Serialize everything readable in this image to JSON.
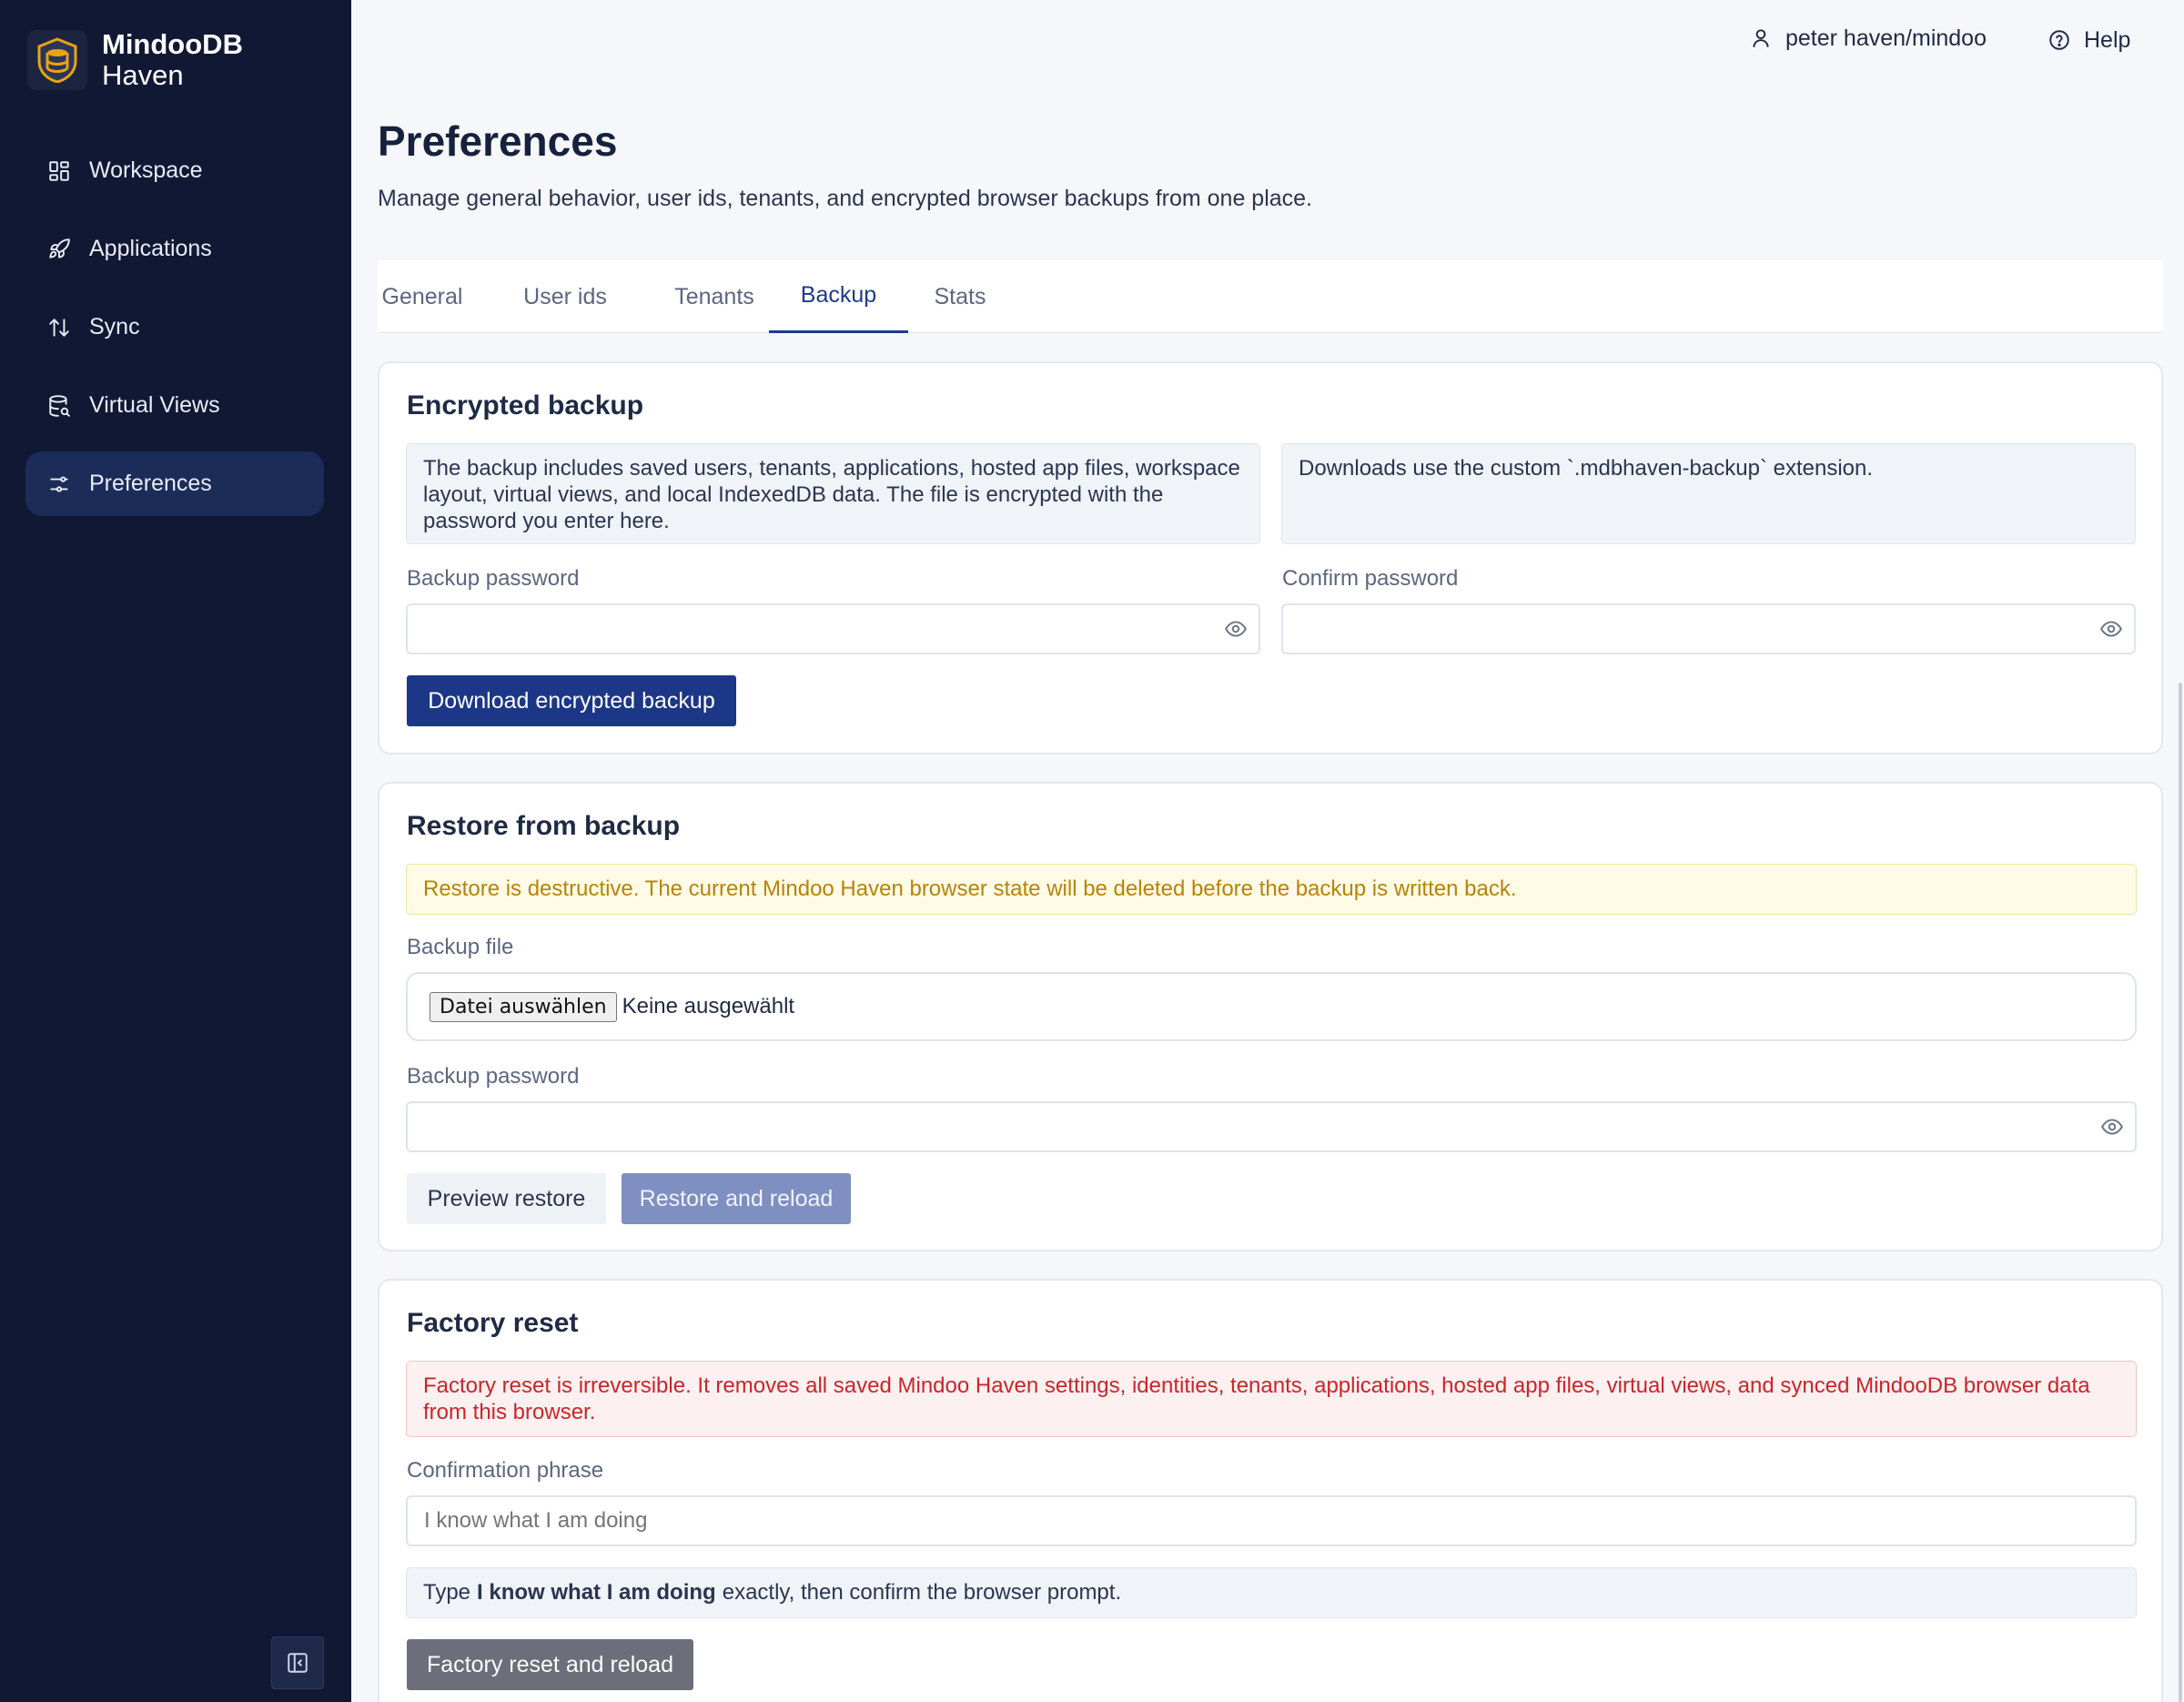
{
  "app": {
    "title": "MindooDB",
    "subtitle": "Haven"
  },
  "sidebar": {
    "items": [
      {
        "label": "Workspace",
        "icon": "workspace-icon",
        "active": false
      },
      {
        "label": "Applications",
        "icon": "rocket-icon",
        "active": false
      },
      {
        "label": "Sync",
        "icon": "sync-arrows-icon",
        "active": false
      },
      {
        "label": "Virtual Views",
        "icon": "database-search-icon",
        "active": false
      },
      {
        "label": "Preferences",
        "icon": "sliders-icon",
        "active": true
      }
    ]
  },
  "topbar": {
    "user": "peter haven/mindoo",
    "help": "Help"
  },
  "page": {
    "title": "Preferences",
    "subtitle": "Manage general behavior, user ids, tenants, and encrypted browser backups from one place."
  },
  "tabs": [
    "General",
    "User ids",
    "Tenants",
    "Backup",
    "Stats"
  ],
  "active_tab": "Backup",
  "encrypted_backup": {
    "title": "Encrypted backup",
    "info_left": "The backup includes saved users, tenants, applications, hosted app files, workspace layout, virtual views, and local IndexedDB data. The file is encrypted with the password you enter here.",
    "info_right": "Downloads use the custom `.mdbhaven-backup` extension.",
    "password_label": "Backup password",
    "confirm_label": "Confirm password",
    "password_value": "",
    "confirm_value": "",
    "download_button": "Download encrypted backup"
  },
  "restore": {
    "title": "Restore from backup",
    "warning": "Restore is destructive. The current Mindoo Haven browser state will be deleted before the backup is written back.",
    "file_label": "Backup file",
    "file_button": "Datei auswählen",
    "file_status": "Keine ausgewählt",
    "password_label": "Backup password",
    "password_value": "",
    "preview_button": "Preview restore",
    "restore_button": "Restore and reload"
  },
  "factory_reset": {
    "title": "Factory reset",
    "danger": "Factory reset is irreversible. It removes all saved Mindoo Haven settings, identities, tenants, applications, hosted app files, virtual views, and synced MindooDB browser data from this browser.",
    "phrase_label": "Confirmation phrase",
    "phrase_placeholder": "I know what I am doing",
    "hint_prefix": "Type",
    "hint_phrase": "I know what I am doing",
    "hint_suffix": "exactly, then confirm the browser prompt.",
    "reset_button": "Factory reset and reload"
  },
  "colors": {
    "sidebar_bg": "#111833",
    "sidebar_active": "#1b2c58",
    "primary": "#1c3787",
    "warning_text": "#b7830a",
    "danger_text": "#c8262a",
    "logo_gold": "#e8a317"
  }
}
